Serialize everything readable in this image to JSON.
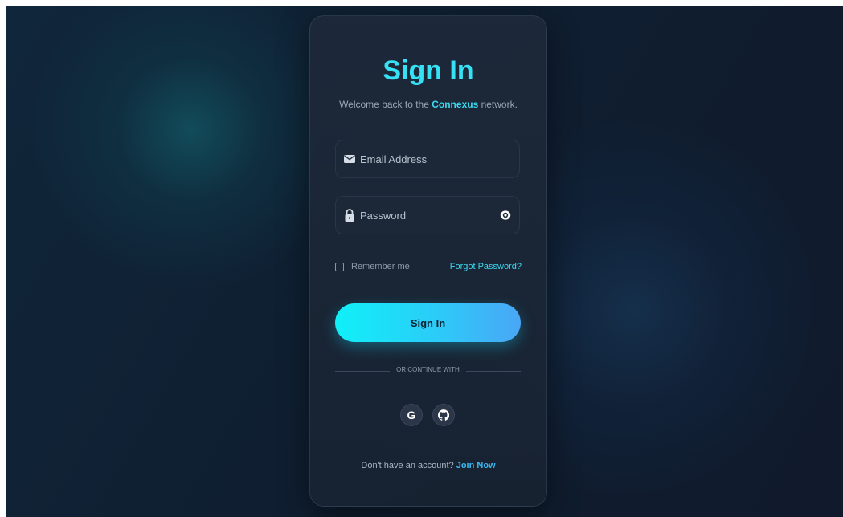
{
  "login": {
    "title": "Sign In",
    "subtitle_prefix": "Welcome back to the ",
    "brand": "Connexus",
    "subtitle_suffix": " network.",
    "email": {
      "placeholder": "Email Address",
      "value": ""
    },
    "password": {
      "placeholder": "Password",
      "value": ""
    },
    "remember_label": "Remember me",
    "remember_checked": false,
    "forgot_label": "Forgot Password?",
    "signin_label": "Sign In",
    "divider_text": "OR CONTINUE WITH",
    "social": {
      "google_glyph": "G",
      "google_icon": "google-icon",
      "github_icon": "github-icon"
    },
    "footer_prefix": "Don't have an account? ",
    "footer_link": "Join Now"
  },
  "colors": {
    "accent": "#36e0f5",
    "button_gradient_start": "#10f0f8",
    "button_gradient_end": "#4aa6f6",
    "card_bg": "#1e2a3a",
    "page_bg": "#0f1e30",
    "link": "#3ab8f0"
  },
  "icons": {
    "email": "envelope-icon",
    "password": "lock-icon",
    "toggle_password": "eye-icon"
  }
}
